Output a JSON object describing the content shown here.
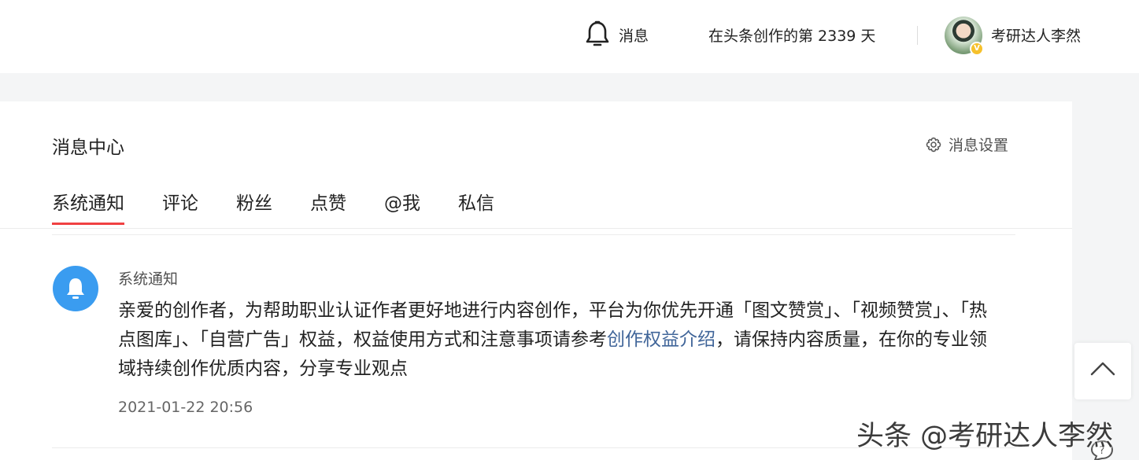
{
  "header": {
    "messages_label": "消息",
    "creation_days_text": "在头条创作的第 2339 天",
    "username": "考研达人李然",
    "verified_badge": "V"
  },
  "message_center": {
    "title": "消息中心",
    "settings_label": "消息设置",
    "tabs": [
      {
        "label": "系统通知",
        "active": true
      },
      {
        "label": "评论",
        "active": false
      },
      {
        "label": "粉丝",
        "active": false
      },
      {
        "label": "点赞",
        "active": false
      },
      {
        "label": "@我",
        "active": false
      },
      {
        "label": "私信",
        "active": false
      }
    ],
    "notification": {
      "sender": "系统通知",
      "body_before_link": "亲爱的创作者，为帮助职业认证作者更好地进行内容创作，平台为你优先开通「图文赞赏」、「视频赞赏」、「热点图库」、「自营广告」权益，权益使用方式和注意事项请参考",
      "link_text": "创作权益介绍",
      "body_after_link": "，请保持内容质量，在你的专业领域持续创作优质内容，分享专业观点",
      "timestamp": "2021-01-22 20:56"
    }
  },
  "watermark": "头条 @考研达人李然",
  "colors": {
    "accent_red": "#f04142",
    "notice_icon_blue": "#3a9cf0",
    "link_blue": "#406599",
    "page_bg": "#f4f5f6"
  },
  "icons": [
    "bell-icon",
    "gear-icon",
    "notification-bell-icon",
    "chevron-up-icon",
    "help-icon"
  ]
}
